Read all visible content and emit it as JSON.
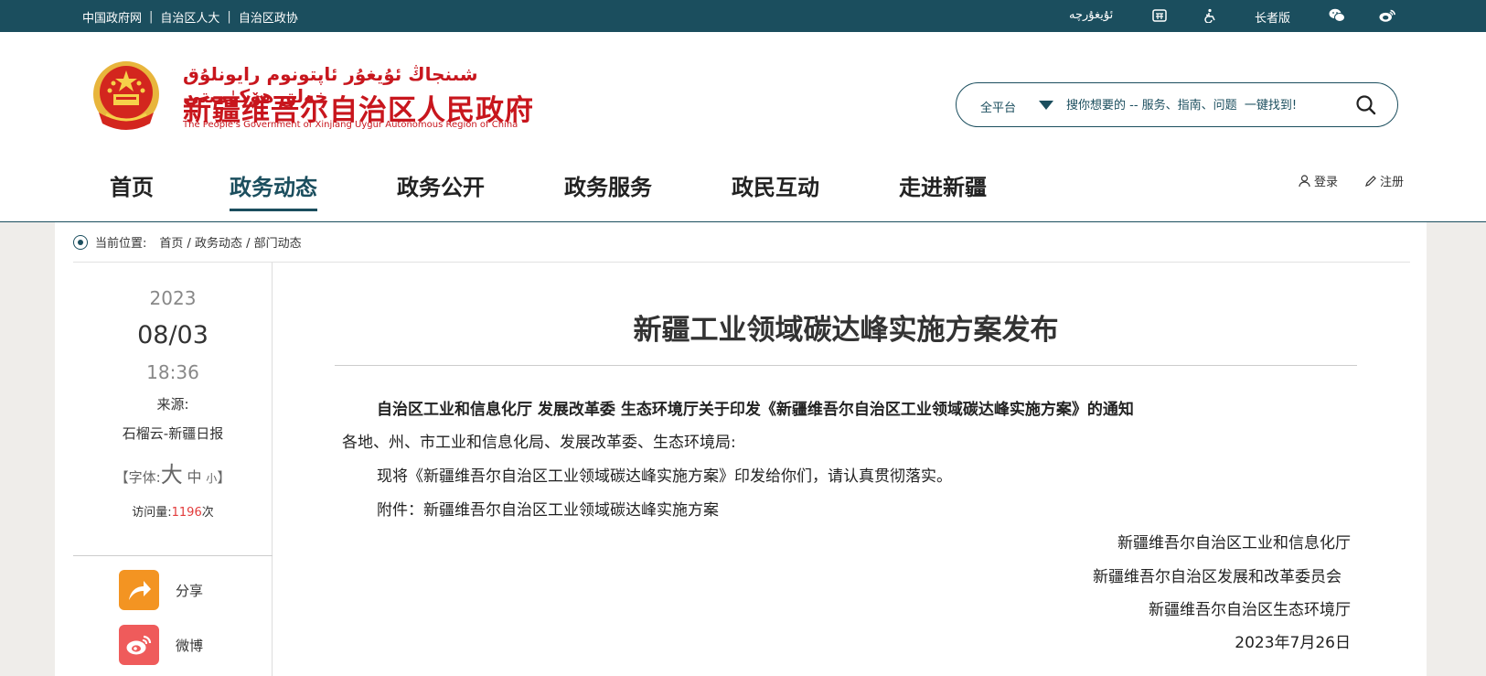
{
  "topbar": {
    "links": [
      "中国政府网",
      "自治区人大",
      "自治区政协"
    ],
    "separator": "|",
    "uyghur": "ئۇيغۇرچە",
    "elder": "长者版"
  },
  "header": {
    "logo_uyghur": "شىنجاڭ ئۇيغۇر ئاپتونوم رايونلۇق خەلق ھۆكۈمىتى",
    "logo_chinese": "新疆维吾尔自治区人民政府",
    "logo_english": "The People's Government of Xinjiang Uygur Autonomous Region of China"
  },
  "search": {
    "scope": "全平台",
    "placeholder": "搜你想要的 -- 服务、指南、问题  一键找到!"
  },
  "nav": {
    "items": [
      "首页",
      "政务动态",
      "政务公开",
      "政务服务",
      "政民互动",
      "走进新疆"
    ],
    "active": "政务动态"
  },
  "auth": {
    "login": "登录",
    "register": "注册"
  },
  "breadcrumb": {
    "label": "当前位置:",
    "path": "首页 / 政务动态 / 部门动态"
  },
  "sidebar": {
    "year": "2023",
    "monthday": "08/03",
    "time": "18:36",
    "source_label": "来源:",
    "source": "石榴云-新疆日报",
    "font_open": "【字体:",
    "font_big": "大",
    "font_mid": "中",
    "font_small": "小",
    "font_close": "】",
    "visits_label": "访问量:",
    "visits": "1196",
    "visits_unit": "次",
    "share_label": "分享",
    "weibo_label": "微博"
  },
  "article": {
    "title": "新疆工业领域碳达峰实施方案发布",
    "notice_title": "自治区工业和信息化厅 发展改革委 生态环境厅关于印发《新疆维吾尔自治区工业领域碳达峰实施方案》的通知",
    "recipients": "各地、州、市工业和信息化局、发展改革委、生态环境局:",
    "body": "现将《新疆维吾尔自治区工业领域碳达峰实施方案》印发给你们，请认真贯彻落实。",
    "attachment": "附件：新疆维吾尔自治区工业领域碳达峰实施方案",
    "sign1": "新疆维吾尔自治区工业和信息化厅",
    "sign2": "新疆维吾尔自治区发展和改革委员会",
    "sign3": "新疆维吾尔自治区生态环境厅",
    "date": "2023年7月26日"
  },
  "colors": {
    "primary": "#1b4e5e",
    "brand_red": "#c8161d",
    "visits": "#e23b3b",
    "share": "#f39422",
    "weibo": "#ef5b5b"
  }
}
